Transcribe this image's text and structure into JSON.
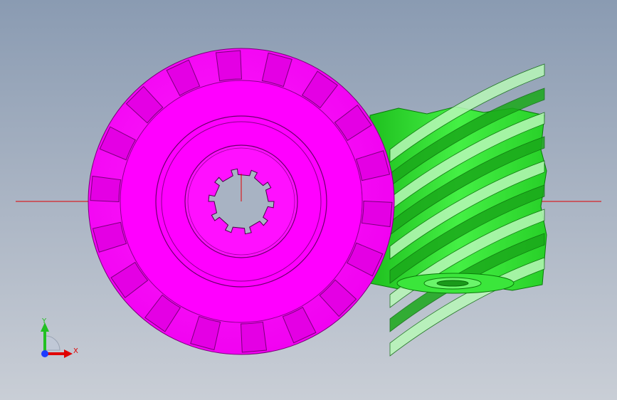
{
  "viewport": {
    "background_top": "#8a9bb2",
    "background_bottom": "#c9ced6"
  },
  "model": {
    "spur_gear": {
      "color": "#ff00ff",
      "teeth": 18,
      "spline_teeth": 10
    },
    "helical_gear": {
      "color": "#33e633",
      "teeth": 10
    },
    "axis_line_color": "#e00000"
  },
  "triad": {
    "x_label": "X",
    "y_label": "Y",
    "x_color": "#e00000",
    "y_color": "#22c022",
    "z_color": "#1e3cff"
  }
}
